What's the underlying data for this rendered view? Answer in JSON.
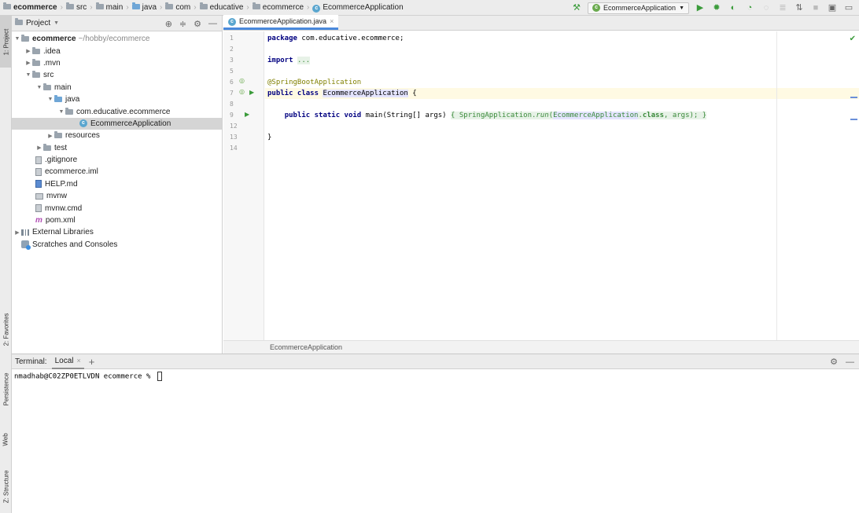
{
  "breadcrumb": [
    "ecommerce",
    "src",
    "main",
    "java",
    "com",
    "educative",
    "ecommerce",
    "EcommerceApplication"
  ],
  "toolbar": {
    "run_config": "EcommerceApplication",
    "icons": [
      "hammer-icon",
      "run-icon",
      "debug-icon",
      "coverage-icon",
      "profile-icon",
      "attach-icon",
      "build-icon",
      "stop-icon",
      "vcs-icon",
      "layout-icon"
    ]
  },
  "left_stripe": {
    "project": "1: Project",
    "favorites": "2: Favorites",
    "persistence": "Persistence",
    "web": "Web",
    "structure": "Z: Structure"
  },
  "project_panel": {
    "title": "Project",
    "tree": [
      {
        "label": "ecommerce",
        "hint": "~/hobby/ecommerce"
      },
      {
        "label": ".idea"
      },
      {
        "label": ".mvn"
      },
      {
        "label": "src"
      },
      {
        "label": "main"
      },
      {
        "label": "java"
      },
      {
        "label": "com.educative.ecommerce"
      },
      {
        "label": "EcommerceApplication"
      },
      {
        "label": "resources"
      },
      {
        "label": "test"
      },
      {
        "label": ".gitignore"
      },
      {
        "label": "ecommerce.iml"
      },
      {
        "label": "HELP.md"
      },
      {
        "label": "mvnw"
      },
      {
        "label": "mvnw.cmd"
      },
      {
        "label": "pom.xml"
      },
      {
        "label": "External Libraries"
      },
      {
        "label": "Scratches and Consoles"
      }
    ]
  },
  "editor": {
    "tab": "EcommerceApplication.java",
    "line_numbers": [
      "1",
      "2",
      "3",
      "5",
      "6",
      "7",
      "8",
      "9",
      "12",
      "13",
      "14"
    ],
    "code": {
      "l1_kw": "package",
      "l1_rest": " com.educative.ecommerce;",
      "l3_kw": "import",
      "l3_fold": "...",
      "l6": "@SpringBootApplication",
      "l7_kw": "public class",
      "l7_cls": "EcommerceApplication",
      "l7_rest": " {",
      "l9_kw": "public static void",
      "l9_a": " main(String[] args) ",
      "l9_b": "{ SpringApplication.",
      "l9_run": "run",
      "l9_c": "(",
      "l9_cls": "EcommerceApplication",
      "l9_d": ".",
      "l9_kw2": "class",
      "l9_e": ", args); }",
      "l13": "}"
    },
    "footer": "EcommerceApplication"
  },
  "terminal": {
    "label": "Terminal:",
    "tab": "Local",
    "add": "+",
    "prompt": "nmadhab@C02ZP0ETLVDN ecommerce % "
  }
}
